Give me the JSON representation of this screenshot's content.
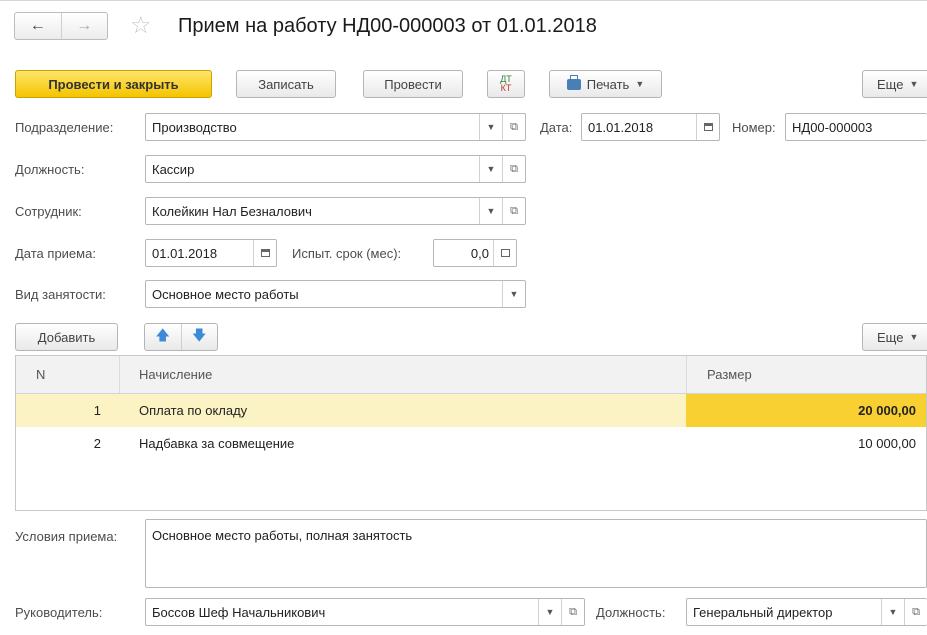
{
  "header": {
    "back_glyph": "←",
    "forward_glyph": "→",
    "favorite_glyph": "☆",
    "title": "Прием на работу НД00-000003 от 01.01.2018"
  },
  "toolbar": {
    "post_close": "Провести и закрыть",
    "save": "Записать",
    "post": "Провести",
    "dt_kt_top": "ДТ",
    "dt_kt_bottom": "КТ",
    "print": "Печать",
    "more": "Еще"
  },
  "form": {
    "department_label": "Подразделение:",
    "department_value": "Производство",
    "date_label": "Дата:",
    "date_value": "01.01.2018",
    "number_label": "Номер:",
    "number_value": "НД00-000003",
    "position_label": "Должность:",
    "position_value": "Кассир",
    "employee_label": "Сотрудник:",
    "employee_value": "Колейкин Нал Безналович",
    "hire_date_label": "Дата приема:",
    "hire_date_value": "01.01.2018",
    "probation_label": "Испыт. срок (мес):",
    "probation_value": "0,0",
    "employment_label": "Вид занятости:",
    "employment_value": "Основное место работы"
  },
  "table_toolbar": {
    "add": "Добавить",
    "more": "Еще"
  },
  "table": {
    "columns": [
      "N",
      "Начисление",
      "Размер"
    ],
    "rows": [
      {
        "n": "1",
        "accrual": "Оплата по окладу",
        "amount": "20 000,00"
      },
      {
        "n": "2",
        "accrual": "Надбавка за совмещение",
        "amount": "10 000,00"
      }
    ]
  },
  "conditions": {
    "label": "Условия приема:",
    "value": "Основное место работы, полная занятость"
  },
  "footer": {
    "manager_label": "Руководитель:",
    "manager_value": "Боссов Шеф Начальникович",
    "manager_position_label": "Должность:",
    "manager_position_value": "Генеральный директор"
  },
  "colors": {
    "primary_button": "#f4c400",
    "selected_row": "#fbf3c4",
    "selected_cell": "#f9d032",
    "arrow_blue": "#3b8bd8"
  }
}
